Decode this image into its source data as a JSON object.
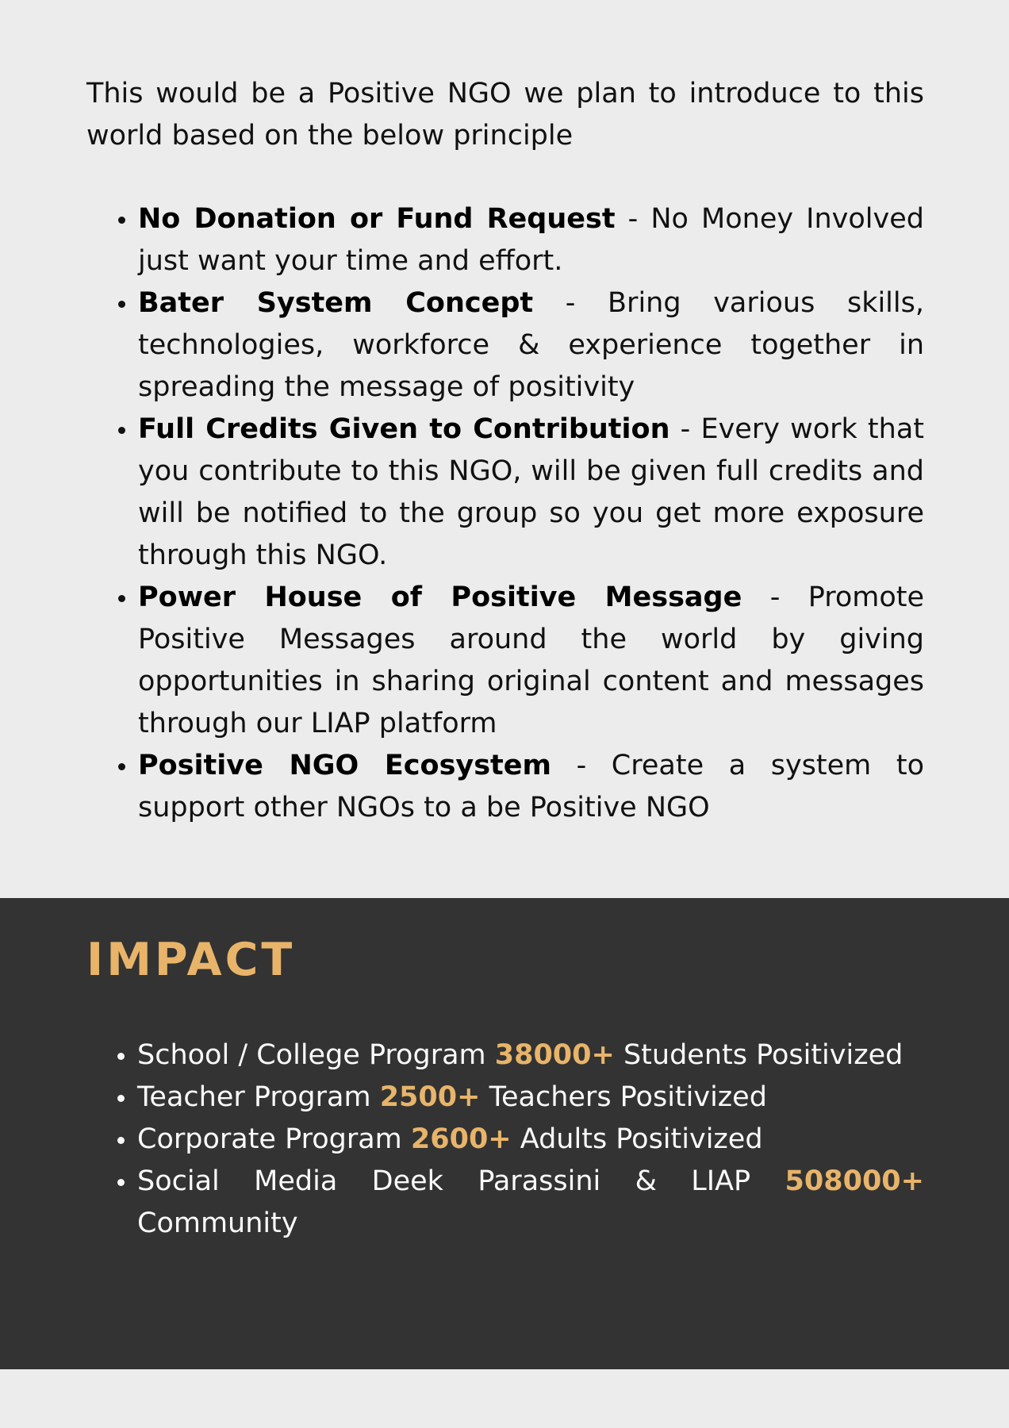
{
  "intro": "This would be a Positive NGO we plan to introduce to this world based on the below principle",
  "principles": [
    {
      "title": "No Donation or Fund Request",
      "text": " - No Money Involved just want your time and effort."
    },
    {
      "title": "Bater System Concept",
      "text": " - Bring various skills, technologies, workforce & experience together in spreading the message of positivity"
    },
    {
      "title": "Full Credits Given to Contribution",
      "text": " - Every work that you contribute to this NGO, will be given full credits and will be notified to the group so you get more exposure through this NGO."
    },
    {
      "title": "Power House of Positive Message",
      "text": " - Promote Positive Messages around the world by giving opportunities in sharing original content and messages through our LIAP platform"
    },
    {
      "title": "Positive NGO Ecosystem",
      "text": " - Create a system to support other NGOs to a be Positive NGO"
    }
  ],
  "impact": {
    "title": "IMPACT",
    "items": [
      {
        "before": "School / College Program ",
        "number": "38000+",
        "after": " Students Positivized"
      },
      {
        "before": "Teacher Program ",
        "number": "2500+",
        "after": " Teachers Positivized"
      },
      {
        "before": "Corporate Program ",
        "number": "2600+",
        "after": " Adults Positivized"
      },
      {
        "before": "Social Media Deek Parassini & LIAP ",
        "number": "508000+",
        "after": " Community"
      }
    ]
  },
  "colors": {
    "page_background": "#ececec",
    "impact_background": "#333333",
    "accent": "#e8b46a",
    "impact_text": "#fafafa"
  }
}
